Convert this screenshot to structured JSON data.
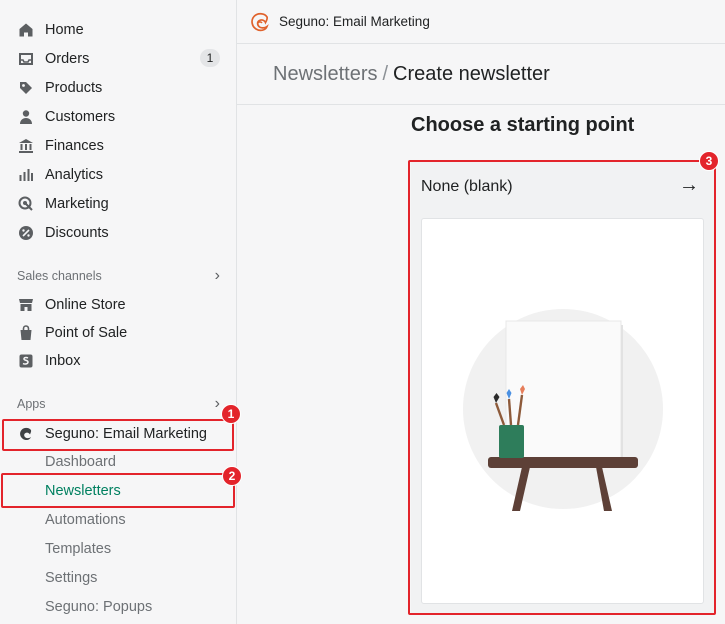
{
  "sidebar": {
    "main_items": [
      {
        "label": "Home",
        "icon": "home-icon"
      },
      {
        "label": "Orders",
        "icon": "orders-icon",
        "badge": "1"
      },
      {
        "label": "Products",
        "icon": "tag-icon"
      },
      {
        "label": "Customers",
        "icon": "person-icon"
      },
      {
        "label": "Finances",
        "icon": "bank-icon"
      },
      {
        "label": "Analytics",
        "icon": "bar-chart-icon"
      },
      {
        "label": "Marketing",
        "icon": "target-icon"
      },
      {
        "label": "Discounts",
        "icon": "discount-icon"
      }
    ],
    "sales_channels": {
      "heading": "Sales channels",
      "items": [
        {
          "label": "Online Store",
          "icon": "store-icon"
        },
        {
          "label": "Point of Sale",
          "icon": "bag-icon"
        },
        {
          "label": "Inbox",
          "icon": "inbox-icon"
        }
      ]
    },
    "apps": {
      "heading": "Apps",
      "app_name": "Seguno: Email Marketing",
      "sub_items": [
        "Dashboard",
        "Newsletters",
        "Automations",
        "Templates",
        "Settings",
        "Seguno: Popups"
      ],
      "active_sub": "Newsletters"
    }
  },
  "topbar": {
    "app_title": "Seguno: Email Marketing"
  },
  "breadcrumb": {
    "parent": "Newsletters",
    "separator": "/",
    "current": "Create newsletter"
  },
  "main": {
    "heading": "Choose a starting point",
    "card": {
      "title": "None (blank)",
      "arrow_icon": "arrow-right-icon"
    }
  },
  "annotations": [
    "1",
    "2",
    "3"
  ],
  "colors": {
    "accent": "#008060",
    "highlight": "#e3242b",
    "brand_logo": "#e0622c"
  }
}
